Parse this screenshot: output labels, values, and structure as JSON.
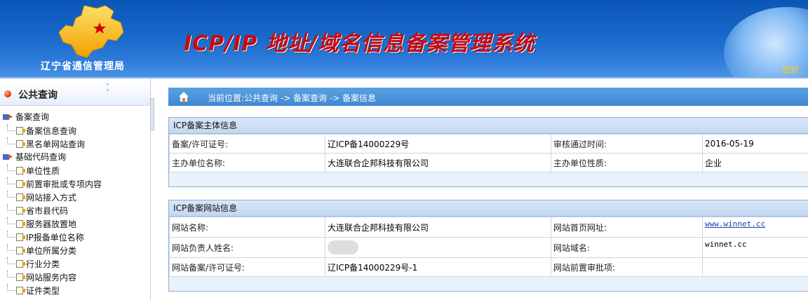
{
  "header": {
    "org_name": "辽宁省通信管理局",
    "title": "ICP/IP 地址/域名信息备案管理系统",
    "welcome": "您好,"
  },
  "sidebar": {
    "section_title": "公共查询",
    "groups": [
      {
        "label": "备案查询",
        "items": [
          "备案信息查询",
          "黑名单网站查询"
        ]
      },
      {
        "label": "基础代码查询",
        "items": [
          "单位性质",
          "前置审批或专项内容",
          "网站接入方式",
          "省市县代码",
          "服务器放置地",
          "IP报备单位名称",
          "单位所属分类",
          "行业分类",
          "网站服务内容",
          "证件类型"
        ]
      }
    ]
  },
  "breadcrumb": {
    "prefix": "当前位置:",
    "path": "公共查询 -> 备案查询 -> 备案信息"
  },
  "entity_panel": {
    "title": "ICP备案主体信息",
    "rows": [
      [
        "备案/许可证号:",
        "辽ICP备14000229号",
        "审核通过时间:",
        "2016-05-19"
      ],
      [
        "主办单位名称:",
        "大连联合企邦科技有限公司",
        "主办单位性质:",
        "企业"
      ]
    ]
  },
  "site_panel": {
    "title": "ICP备案网站信息",
    "rows": [
      [
        "网站名称:",
        "大连联合企邦科技有限公司",
        "网站首页网址:",
        "www.winnet.cc"
      ],
      [
        "网站负责人姓名:",
        "",
        "网站域名:",
        "winnet.cc"
      ],
      [
        "网站备案/许可证号:",
        "辽ICP备14000229号-1",
        "网站前置审批项:",
        ""
      ]
    ]
  },
  "colors": {
    "header_blue": "#1565c8",
    "title_red": "#c60a14",
    "welcome_yellow": "#ffd400",
    "crumb_blue": "#4a93da"
  }
}
